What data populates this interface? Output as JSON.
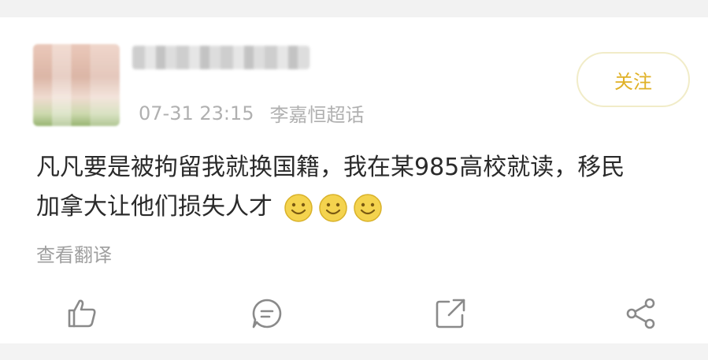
{
  "post": {
    "time": "07-31 23:15",
    "source": "李嘉恒超话",
    "follow_label": "关注",
    "text_line1": "凡凡要是被拘留我就换国籍，我在某985高校就读，移民",
    "text_line2": "加拿大让他们损失人才",
    "emoji_icons": [
      "smile-emoji-icon",
      "smile-emoji-icon",
      "smile-emoji-icon"
    ],
    "translate_label": "查看翻译"
  },
  "actions": [
    {
      "name": "like-button",
      "icon": "thumbs-up-icon"
    },
    {
      "name": "comment-button",
      "icon": "comment-icon"
    },
    {
      "name": "repost-button",
      "icon": "external-link-icon"
    },
    {
      "name": "share-button",
      "icon": "share-icon"
    }
  ],
  "colors": {
    "follow_text": "#e0b126",
    "meta_text": "#b0b0b0",
    "body_text": "#2a2a2a",
    "emoji_face": "#f4d34e"
  }
}
